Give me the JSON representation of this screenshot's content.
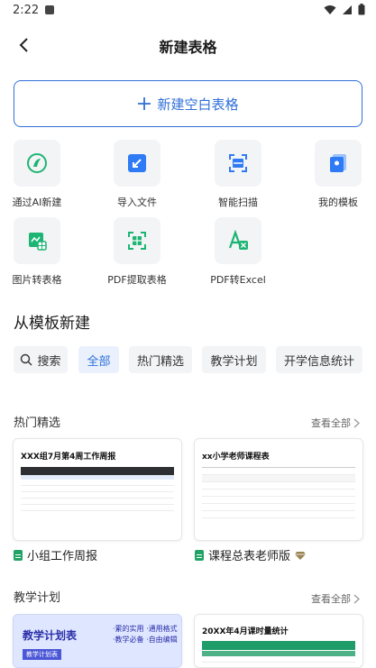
{
  "status": {
    "time": "2:22"
  },
  "header": {
    "title": "新建表格"
  },
  "new_blank": {
    "label": "新建空白表格"
  },
  "tools": [
    {
      "label": "通过AI新建",
      "icon": "ai-icon"
    },
    {
      "label": "导入文件",
      "icon": "import-icon"
    },
    {
      "label": "智能扫描",
      "icon": "scan-icon"
    },
    {
      "label": "我的模板",
      "icon": "template-icon"
    },
    {
      "label": "图片转表格",
      "icon": "image-to-table-icon"
    },
    {
      "label": "PDF提取表格",
      "icon": "pdf-extract-icon"
    },
    {
      "label": "PDF转Excel",
      "icon": "pdf-to-excel-icon"
    }
  ],
  "templates": {
    "title": "从模板新建",
    "chips": [
      "搜索",
      "全部",
      "热门精选",
      "教学计划",
      "开学信息统计"
    ],
    "groups": [
      {
        "title": "热门精选",
        "see_all": "查看全部",
        "cards": [
          {
            "name": "小组工作周报",
            "thumb_title": "XXX组7月第4周工作周报"
          },
          {
            "name": "课程总表老师版",
            "thumb_title": "xx小学老师课程表"
          }
        ]
      },
      {
        "title": "教学计划",
        "see_all": "查看全部",
        "cards": [
          {
            "thumb_title": "教学计划表",
            "thumb_sub": "教学计划表",
            "bullets": [
              "·累的实用",
              "·通用格式",
              "·教学必备",
              "·自由编辑"
            ]
          },
          {
            "thumb_title": "20XX年4月课时量统计"
          }
        ]
      }
    ]
  },
  "colors": {
    "accent": "#2f6fd8",
    "sheet_green": "#21a366",
    "chip_bg": "#f3f4f6"
  }
}
